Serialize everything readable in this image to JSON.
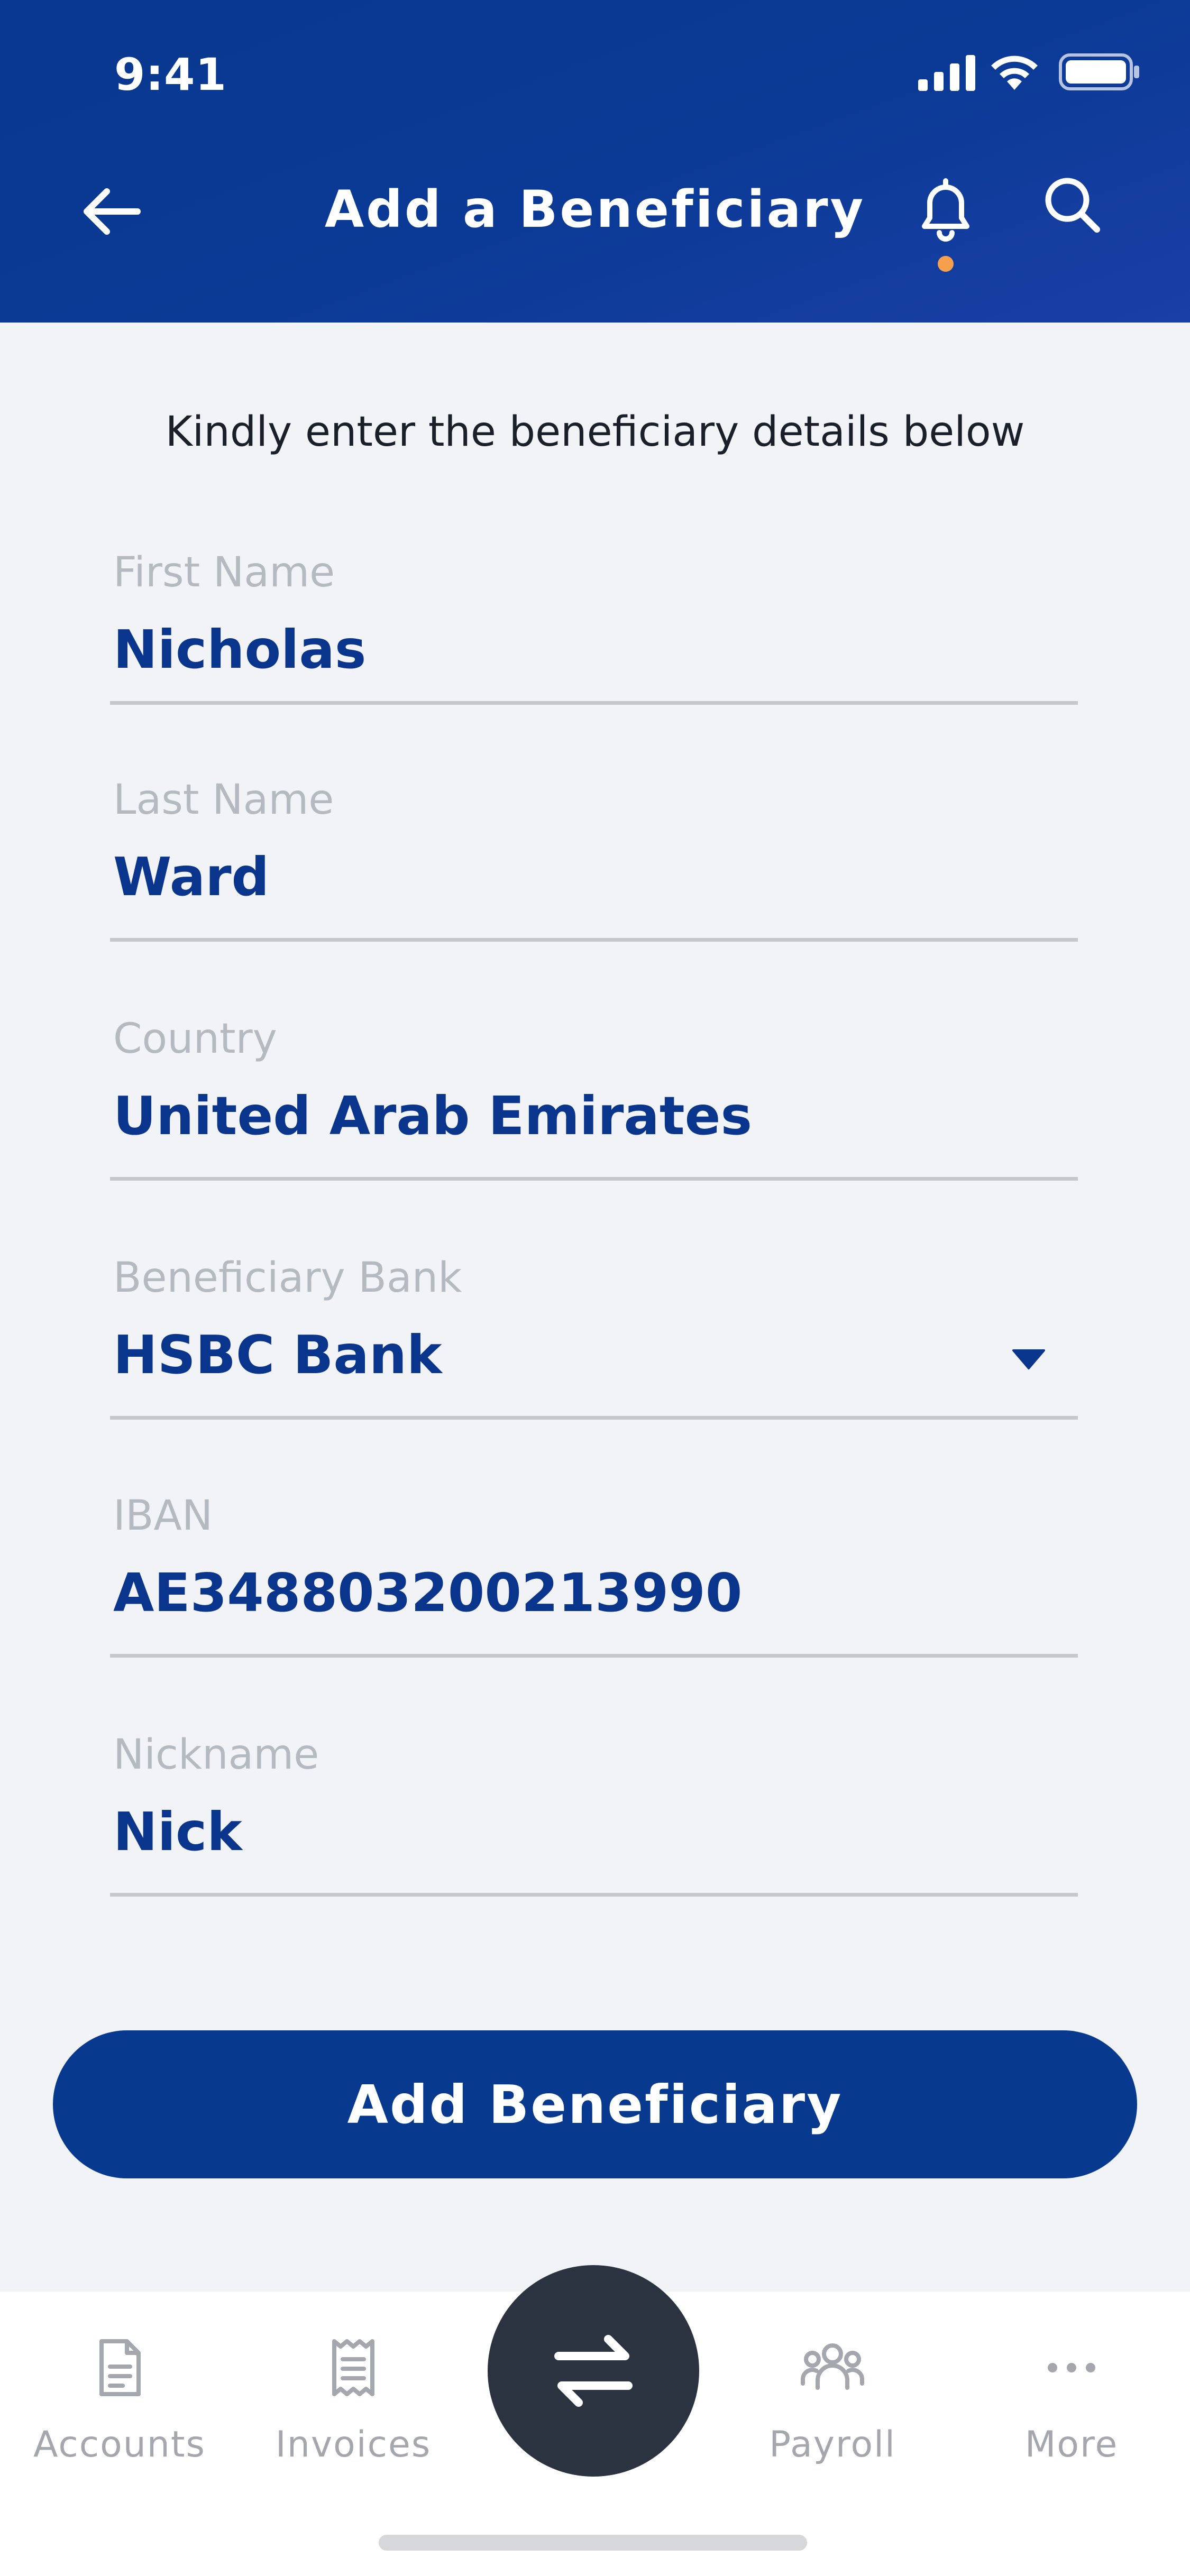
{
  "status_bar": {
    "time": "9:41"
  },
  "header": {
    "title": "Add a Beneficiary"
  },
  "intro_text": "Kindly enter the beneficiary details below",
  "form": {
    "fields": [
      {
        "label": "First Name",
        "value": "Nicholas"
      },
      {
        "label": "Last Name",
        "value": "Ward"
      },
      {
        "label": "Country",
        "value": "United Arab Emirates"
      },
      {
        "label": "Beneficiary Bank",
        "value": "HSBC Bank"
      },
      {
        "label": "IBAN",
        "value": "AE348803200213990"
      },
      {
        "label": "Nickname",
        "value": "Nick"
      }
    ],
    "submit_label": "Add Beneficiary"
  },
  "tabbar": {
    "items": [
      {
        "label": "Accounts",
        "icon": "document-icon"
      },
      {
        "label": "Invoices",
        "icon": "receipt-icon"
      },
      {
        "label": "",
        "icon": "swap-icon"
      },
      {
        "label": "Payroll",
        "icon": "people-icon"
      },
      {
        "label": "More",
        "icon": "more-icon"
      }
    ]
  },
  "colors": {
    "brand_blue": "#0a358c",
    "header_blue": "#0b3a96",
    "notification_dot": "#f6a04d",
    "fab_dark": "#2b3340"
  }
}
